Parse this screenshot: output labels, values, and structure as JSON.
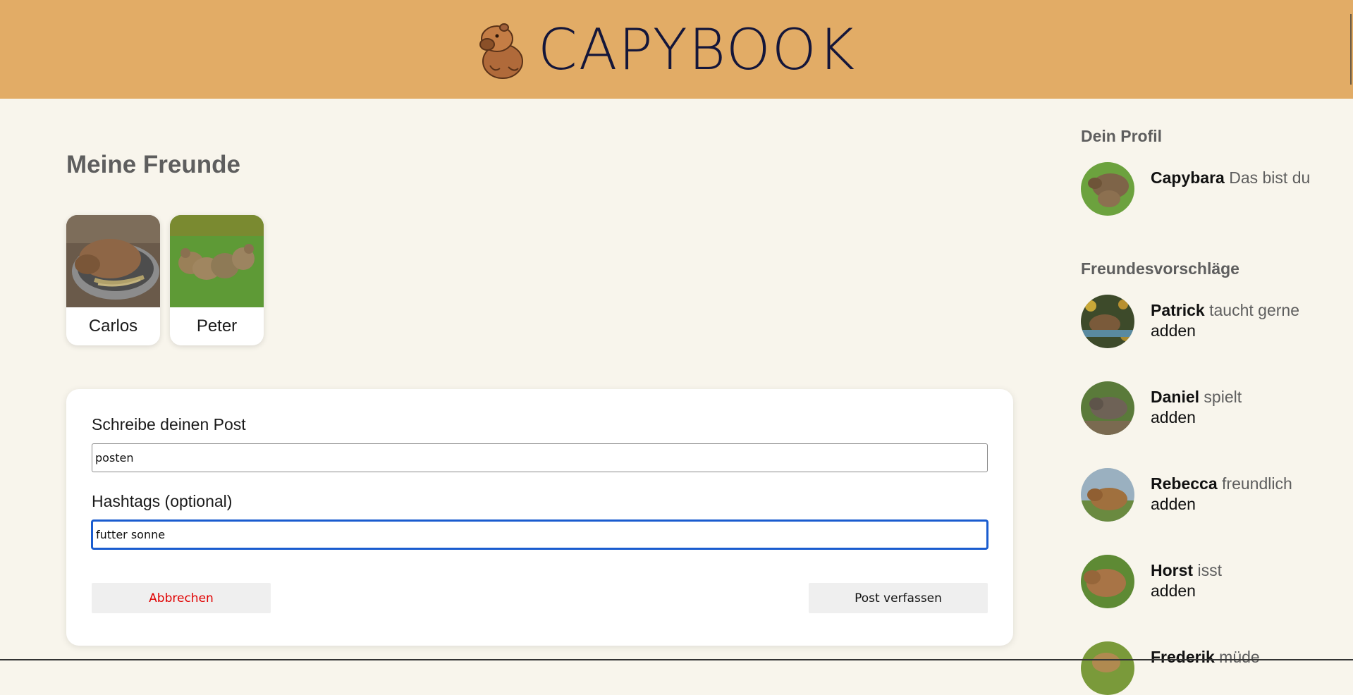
{
  "header": {
    "brand": "CAPYBOOK",
    "logo_icon": "capybara-logo-icon",
    "background": "#e2ac66",
    "brand_color": "#14163a"
  },
  "friends_section": {
    "title": "Meine Freunde",
    "friends": [
      {
        "name": "Carlos",
        "photo": "capybara-sleeping-in-bowl"
      },
      {
        "name": "Peter",
        "photo": "capybara-group-on-grass"
      }
    ]
  },
  "post_form": {
    "post_label": "Schreibe deinen Post",
    "post_value": "posten",
    "hashtags_label": "Hashtags (optional)",
    "hashtags_value": "futter sonne",
    "cancel_label": "Abbrechen",
    "submit_label": "Post verfassen",
    "cancel_color": "#e00000"
  },
  "sidebar": {
    "profile_heading": "Dein Profil",
    "profile": {
      "name": "Capybara",
      "status": "Das bist du"
    },
    "suggestions_heading": "Freundesvorschläge",
    "add_label": "adden",
    "suggestions": [
      {
        "name": "Patrick",
        "status": "taucht gerne"
      },
      {
        "name": "Daniel",
        "status": "spielt"
      },
      {
        "name": "Rebecca",
        "status": "freundlich"
      },
      {
        "name": "Horst",
        "status": "isst"
      },
      {
        "name": "Frederik",
        "status": "müde"
      }
    ]
  },
  "colors": {
    "page_background": "#f8f5ec",
    "heading_gray": "#5e5e5e",
    "focus_blue": "#1a5ccf"
  }
}
